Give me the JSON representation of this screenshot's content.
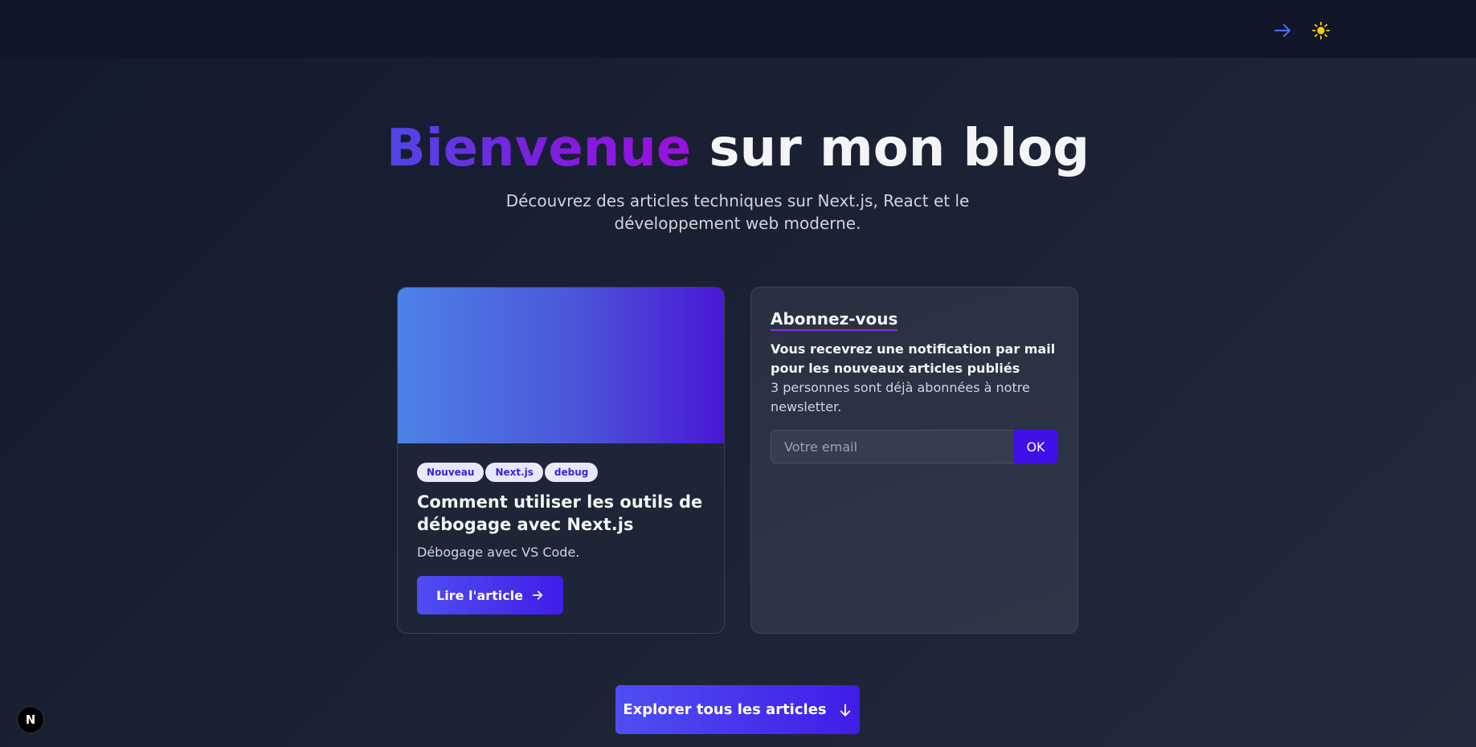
{
  "header": {
    "login_icon": "arrow-right-icon",
    "theme_icon": "sun-icon",
    "theme_color": "#facc15",
    "login_color": "#4f6ef2"
  },
  "hero": {
    "title_highlight": "Bienvenue",
    "title_rest": " sur mon blog",
    "subtitle": "Découvrez des articles techniques sur Next.js, React et le développement web moderne."
  },
  "article": {
    "tags": [
      "Nouveau",
      "Next.js",
      "debug"
    ],
    "title": "Comment utiliser les outils de débogage avec Next.js",
    "description": "Débogage avec VS Code.",
    "cta_label": "Lire l'article"
  },
  "newsletter": {
    "title": "Abonnez-vous",
    "headline": "Vous recevrez une notification par mail pour les nouveaux articles publiés",
    "subscribers_text": "3 personnes sont déjà abonnées à notre newsletter.",
    "email_placeholder": "Votre email",
    "email_value": "",
    "submit_label": "OK"
  },
  "explore": {
    "label": "Explorer tous les articles"
  },
  "dev_badge": {
    "label": "N"
  },
  "colors": {
    "accent": "#4f46e5",
    "accent_dark": "#4011e6",
    "background": "#1a2133"
  }
}
